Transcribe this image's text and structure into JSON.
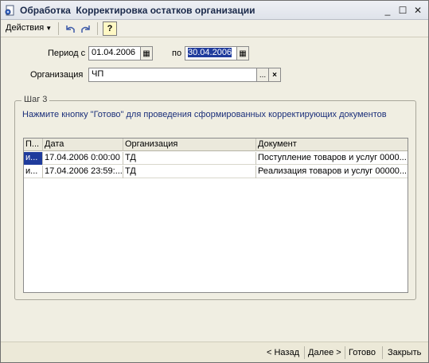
{
  "window": {
    "title": "Обработка  Корректировка остатков организации",
    "icons": {
      "app": "gear-doc-icon",
      "minimize": "minimize-icon",
      "maximize": "maximize-icon",
      "close": "close-icon"
    }
  },
  "toolbar": {
    "actions_label": "Действия",
    "help_label": "?"
  },
  "form": {
    "period_label": "Период с",
    "period_from": "01.04.2006",
    "period_to_label": "по",
    "period_to": "30.04.2006",
    "org_label": "Организация",
    "org_value": "ЧП",
    "select_btn": "...",
    "clear_btn": "×"
  },
  "step": {
    "title": "Шаг 3",
    "note": "Нажмите кнопку \"Готово\" для проведения сформированных корректирующих документов"
  },
  "table": {
    "columns": [
      "П...",
      "Дата",
      "Организация",
      "Документ"
    ],
    "rows": [
      [
        "и...",
        "17.04.2006 0:00:00",
        "ТД",
        "Поступление товаров и услуг 0000..."
      ],
      [
        "и...",
        "17.04.2006 23:59:...",
        "ТД",
        "Реализация товаров и услуг 00000..."
      ]
    ]
  },
  "footer": {
    "back": "< Назад",
    "next": "Далее >",
    "done": "Готово",
    "close": "Закрыть"
  }
}
